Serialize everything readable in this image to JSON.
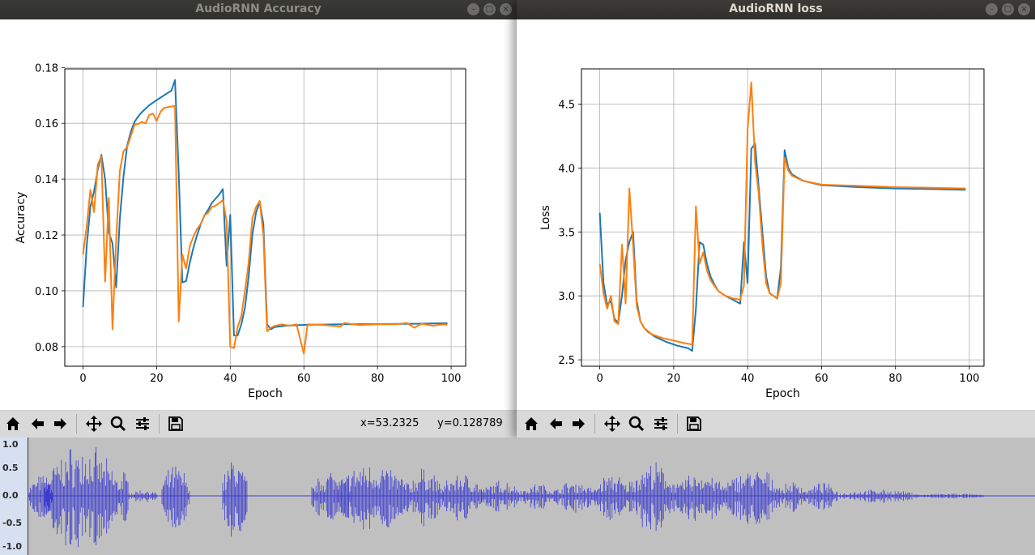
{
  "windows": {
    "accuracy": {
      "title": "AudioRNN Accuracy"
    },
    "loss": {
      "title": "AudioRNN loss"
    }
  },
  "toolbar": {
    "icons": [
      "home-icon",
      "back-arrow-icon",
      "forward-arrow-icon",
      "pan-icon",
      "zoom-icon",
      "configure-subplots-icon",
      "save-icon"
    ],
    "coord_x": "x=53.2325",
    "coord_y": "y=0.128789"
  },
  "audio_track": {
    "ruler_labels": [
      "1.0",
      "0.5",
      "0.0",
      "-0.5",
      "-1.0"
    ],
    "waveform_color": "#3c3cd0"
  },
  "colors": {
    "series_blue": "#1f77b4",
    "series_orange": "#ff7f0e"
  },
  "chart_data": [
    {
      "type": "line",
      "title": "",
      "xlabel": "Epoch",
      "ylabel": "Accuracy",
      "xlim": [
        -4.95,
        103.95
      ],
      "ylim": [
        0.073,
        0.1795
      ],
      "xticks": [
        "0",
        "20",
        "40",
        "60",
        "80",
        "100"
      ],
      "yticks": [
        "0.08",
        "0.10",
        "0.12",
        "0.14",
        "0.16",
        "0.18"
      ],
      "xtick_values": [
        0,
        20,
        40,
        60,
        80,
        100
      ],
      "ytick_values": [
        0.08,
        0.1,
        0.12,
        0.14,
        0.16,
        0.18
      ],
      "grid": true,
      "series": [
        {
          "color": "#1f77b4",
          "points": [
            [
              0,
              0.0942
            ],
            [
              1,
              0.1158
            ],
            [
              2,
              0.1301
            ],
            [
              3,
              0.1356
            ],
            [
              4,
              0.1434
            ],
            [
              5,
              0.1487
            ],
            [
              6,
              0.14
            ],
            [
              7,
              0.121
            ],
            [
              8,
              0.117
            ],
            [
              9,
              0.1012
            ],
            [
              10,
              0.126
            ],
            [
              11,
              0.141
            ],
            [
              12,
              0.152
            ],
            [
              13,
              0.157
            ],
            [
              14,
              0.1605
            ],
            [
              15,
              0.1625
            ],
            [
              16,
              0.164
            ],
            [
              18,
              0.1665
            ],
            [
              20,
              0.1683
            ],
            [
              22,
              0.17
            ],
            [
              24,
              0.1717
            ],
            [
              25,
              0.1755
            ],
            [
              26,
              0.142
            ],
            [
              27,
              0.103
            ],
            [
              28,
              0.1035
            ],
            [
              29,
              0.11
            ],
            [
              30,
              0.1155
            ],
            [
              31,
              0.12
            ],
            [
              32,
              0.124
            ],
            [
              33,
              0.127
            ],
            [
              34,
              0.129
            ],
            [
              35,
              0.1315
            ],
            [
              37,
              0.1345
            ],
            [
              38,
              0.1364
            ],
            [
              39,
              0.109
            ],
            [
              40,
              0.1272
            ],
            [
              41,
              0.084
            ],
            [
              42,
              0.084
            ],
            [
              43,
              0.088
            ],
            [
              44,
              0.094
            ],
            [
              45,
              0.105
            ],
            [
              46,
              0.12
            ],
            [
              47,
              0.128
            ],
            [
              48,
              0.1318
            ],
            [
              49,
              0.124
            ],
            [
              50,
              0.088
            ],
            [
              51,
              0.0862
            ],
            [
              52,
              0.087
            ],
            [
              55,
              0.0875
            ],
            [
              60,
              0.0878
            ],
            [
              70,
              0.088
            ],
            [
              80,
              0.0881
            ],
            [
              90,
              0.0882
            ],
            [
              99,
              0.0884
            ]
          ]
        },
        {
          "color": "#ff7f0e",
          "points": [
            [
              0,
              0.113
            ],
            [
              1,
              0.123
            ],
            [
              2,
              0.1362
            ],
            [
              3,
              0.1282
            ],
            [
              4,
              0.1452
            ],
            [
              5,
              0.1482
            ],
            [
              6,
              0.1033
            ],
            [
              7,
              0.1333
            ],
            [
              8,
              0.0862
            ],
            [
              9,
              0.1182
            ],
            [
              10,
              0.143
            ],
            [
              11,
              0.15
            ],
            [
              12,
              0.1515
            ],
            [
              13,
              0.1555
            ],
            [
              14,
              0.1595
            ],
            [
              15,
              0.1598
            ],
            [
              16,
              0.1605
            ],
            [
              17,
              0.16
            ],
            [
              18,
              0.163
            ],
            [
              19,
              0.1635
            ],
            [
              20,
              0.1608
            ],
            [
              21,
              0.164
            ],
            [
              22,
              0.1655
            ],
            [
              24,
              0.166
            ],
            [
              25,
              0.1662
            ],
            [
              26,
              0.089
            ],
            [
              27,
              0.113
            ],
            [
              28,
              0.108
            ],
            [
              29,
              0.116
            ],
            [
              30,
              0.1195
            ],
            [
              31,
              0.1222
            ],
            [
              32,
              0.124
            ],
            [
              33,
              0.127
            ],
            [
              34,
              0.128
            ],
            [
              35,
              0.13
            ],
            [
              36,
              0.1305
            ],
            [
              37,
              0.1315
            ],
            [
              38,
              0.1325
            ],
            [
              39,
              0.125
            ],
            [
              40,
              0.08
            ],
            [
              41,
              0.0795
            ],
            [
              42,
              0.087
            ],
            [
              43,
              0.091
            ],
            [
              44,
              0.1
            ],
            [
              45,
              0.11
            ],
            [
              46,
              0.126
            ],
            [
              47,
              0.13
            ],
            [
              48,
              0.1322
            ],
            [
              49,
              0.12
            ],
            [
              50,
              0.0855
            ],
            [
              51,
              0.0868
            ],
            [
              52,
              0.0874
            ],
            [
              54,
              0.088
            ],
            [
              56,
              0.0875
            ],
            [
              58,
              0.088
            ],
            [
              60,
              0.0775
            ],
            [
              61,
              0.088
            ],
            [
              65,
              0.0878
            ],
            [
              70,
              0.0872
            ],
            [
              71,
              0.0885
            ],
            [
              75,
              0.0877
            ],
            [
              80,
              0.088
            ],
            [
              85,
              0.088
            ],
            [
              88,
              0.0885
            ],
            [
              90,
              0.0868
            ],
            [
              92,
              0.0882
            ],
            [
              95,
              0.0875
            ],
            [
              98,
              0.088
            ],
            [
              99,
              0.0878
            ]
          ]
        }
      ]
    },
    {
      "type": "line",
      "title": "",
      "xlabel": "Epoch",
      "ylabel": "Loss",
      "xlim": [
        -4.95,
        103.95
      ],
      "ylim": [
        2.45,
        4.775
      ],
      "xticks": [
        "0",
        "20",
        "40",
        "60",
        "80",
        "100"
      ],
      "yticks": [
        "2.5",
        "3.0",
        "3.5",
        "4.0",
        "4.5"
      ],
      "xtick_values": [
        0,
        20,
        40,
        60,
        80,
        100
      ],
      "ytick_values": [
        2.5,
        3.0,
        3.5,
        4.0,
        4.5
      ],
      "grid": true,
      "series": [
        {
          "color": "#1f77b4",
          "points": [
            [
              0,
              3.65
            ],
            [
              1,
              3.1
            ],
            [
              2,
              2.93
            ],
            [
              3,
              2.96
            ],
            [
              4,
              2.82
            ],
            [
              5,
              2.79
            ],
            [
              6,
              3.0
            ],
            [
              7,
              3.28
            ],
            [
              8,
              3.42
            ],
            [
              9,
              3.5
            ],
            [
              10,
              2.96
            ],
            [
              11,
              2.8
            ],
            [
              12,
              2.75
            ],
            [
              13,
              2.72
            ],
            [
              15,
              2.68
            ],
            [
              18,
              2.64
            ],
            [
              21,
              2.61
            ],
            [
              24,
              2.59
            ],
            [
              25,
              2.57
            ],
            [
              26,
              2.9
            ],
            [
              27,
              3.42
            ],
            [
              28,
              3.4
            ],
            [
              29,
              3.25
            ],
            [
              30,
              3.15
            ],
            [
              31,
              3.09
            ],
            [
              32,
              3.04
            ],
            [
              34,
              3.0
            ],
            [
              36,
              2.97
            ],
            [
              38,
              2.94
            ],
            [
              39,
              3.42
            ],
            [
              40,
              3.1
            ],
            [
              41,
              4.15
            ],
            [
              42,
              4.19
            ],
            [
              43,
              3.85
            ],
            [
              44,
              3.5
            ],
            [
              45,
              3.15
            ],
            [
              46,
              3.02
            ],
            [
              47,
              3.0
            ],
            [
              48,
              2.98
            ],
            [
              49,
              3.22
            ],
            [
              50,
              4.14
            ],
            [
              51,
              4.0
            ],
            [
              52,
              3.95
            ],
            [
              55,
              3.9
            ],
            [
              60,
              3.865
            ],
            [
              70,
              3.85
            ],
            [
              80,
              3.84
            ],
            [
              90,
              3.835
            ],
            [
              99,
              3.83
            ]
          ]
        },
        {
          "color": "#ff7f0e",
          "points": [
            [
              0,
              3.25
            ],
            [
              1,
              3.02
            ],
            [
              2,
              2.9
            ],
            [
              3,
              3.0
            ],
            [
              4,
              2.8
            ],
            [
              5,
              2.78
            ],
            [
              6,
              3.4
            ],
            [
              7,
              2.94
            ],
            [
              8,
              3.84
            ],
            [
              9,
              3.4
            ],
            [
              10,
              2.92
            ],
            [
              11,
              2.8
            ],
            [
              12,
              2.75
            ],
            [
              14,
              2.7
            ],
            [
              17,
              2.67
            ],
            [
              20,
              2.65
            ],
            [
              23,
              2.63
            ],
            [
              25,
              2.62
            ],
            [
              26,
              3.7
            ],
            [
              27,
              3.25
            ],
            [
              28,
              3.34
            ],
            [
              29,
              3.2
            ],
            [
              30,
              3.12
            ],
            [
              31,
              3.08
            ],
            [
              32,
              3.04
            ],
            [
              34,
              3.0
            ],
            [
              36,
              2.98
            ],
            [
              38,
              2.97
            ],
            [
              39,
              3.08
            ],
            [
              40,
              4.3
            ],
            [
              41,
              4.67
            ],
            [
              42,
              4.05
            ],
            [
              43,
              3.8
            ],
            [
              44,
              3.4
            ],
            [
              45,
              3.1
            ],
            [
              46,
              3.02
            ],
            [
              47,
              3.0
            ],
            [
              48,
              2.98
            ],
            [
              49,
              3.1
            ],
            [
              50,
              4.08
            ],
            [
              51,
              3.98
            ],
            [
              52,
              3.94
            ],
            [
              55,
              3.9
            ],
            [
              60,
              3.87
            ],
            [
              70,
              3.86
            ],
            [
              80,
              3.85
            ],
            [
              90,
              3.845
            ],
            [
              99,
              3.84
            ]
          ]
        }
      ]
    }
  ]
}
